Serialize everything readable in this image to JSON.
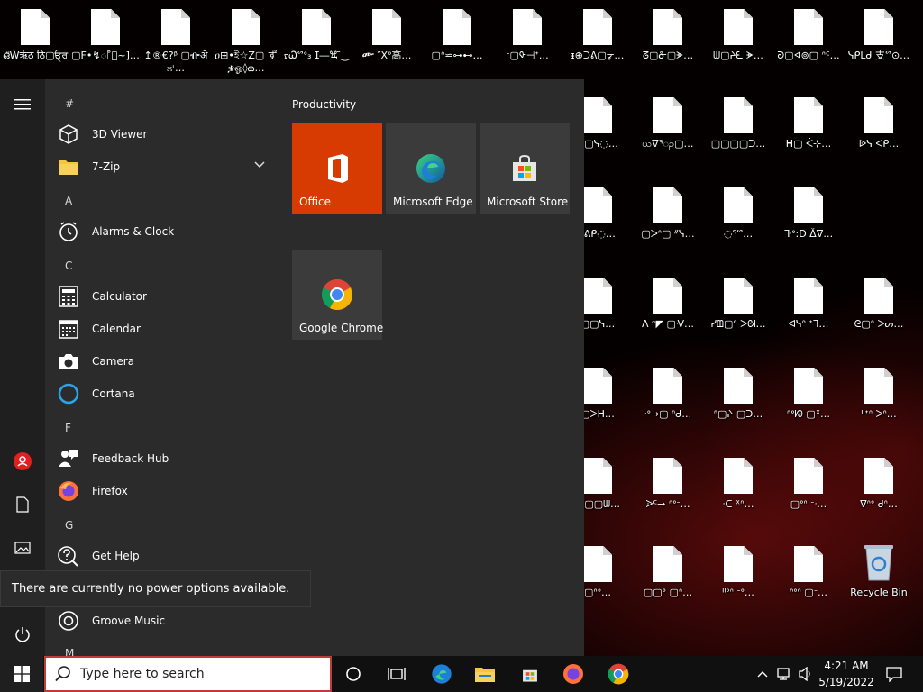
{
  "desktop": {
    "icons_row1": [
      {
        "label": "ഒ̈W̃ऋ॑ठ ठि▢ਓ੍ਰ"
      },
      {
        "label": "▢F•↯ါ ̊ႅ~]…"
      },
      {
        "label": "↥®€?ᵝ ▢ᎇऄ೫ᶥ…"
      },
      {
        "label": "ዐ⊞•ই☆Z▢ ずቌஓ◊ౚ…"
      },
      {
        "label": "ᠷᏇᔥᐤ₃ ⵊ―ꖐ ̄‿"
      },
      {
        "label": "ᎀ ″Xᐤ高…"
      },
      {
        "label": "▢ᐢ⋍⊶⊷…"
      },
      {
        "label": "ᐨ▢ᡐ⊣ᐩ…"
      },
      {
        "label": "ᵻ⊕ᑐᕕ▢ᡒ…"
      },
      {
        "label": "ᘔ▢ᓁ▢ᗘ…"
      },
      {
        "label": "ᗯ▢ᔨᘍ ᗘ…"
      },
      {
        "label": "ᘐ▢ᗏ⊚▢ ᐢᑦ…"
      },
      {
        "label": "ᓭᑭᒪᑯ 支ᔥ⊙…"
      }
    ],
    "icons_grid_labels": [
      [
        "ᑕ▢ᓭ◌…",
        "ယᐁᕐၣ▢…",
        "▢▢▢▢ᑐ…",
        "ᕼ▢ ᐹ⊹…"
      ],
      [
        "ᐠᕕᑭ◌…",
        "▢ᐳᐢ▢ ᐥᓭ…",
        "◌ᕐᔥ…",
        "ᒭᐤ:D ᐂᐁ…",
        "ᐉᓭ ᐸᑭ…"
      ],
      [
        "▢▢ᓭ…",
        "ᐱ ᵔ◤ ▢ᐺ…",
        "ᓯᗶ▢ᐤ ᐳᘛ…",
        "ᐊᓭᐢ ᐩᒣ…",
        "ᘓ▢ᐢ ᐳᔕ…"
      ],
      [
        "▢ᐳᕼ…",
        "ᐧᐤ→▢ ᐢᑯ…",
        "ᐢ▢ᔨ ▢ᑐ…",
        "ᐢᐤᘘ ▢ᕽ…",
        "ᐦᐩᐢ ᐳᐢ…"
      ],
      [
        "▢▢▢ᗯ…",
        "ᐷᑦ→ ᐢᐤᐨ…",
        "ᐧᑕ ᕽᐢ…",
        "▢ᐤᐢ ᐨᐧ…",
        "ᐁᐢᐤ ᑯᐢ…"
      ],
      [
        "▢ᐢᐤ…",
        "▢▢ᐤ ▢ᐢ…",
        "ᐦᐤᐢ ᐨᐤ…",
        "ᐢᐤᐢ ▢ᐨ…",
        "Recycle Bin"
      ]
    ]
  },
  "start_menu": {
    "group_hash": "#",
    "apps": [
      {
        "label": "3D Viewer",
        "icon": "cube-icon"
      },
      {
        "label": "7-Zip",
        "icon": "folder-icon"
      },
      {
        "label": "Alarms & Clock",
        "icon": "clock-icon"
      },
      {
        "label": "Calculator",
        "icon": "calculator-icon"
      },
      {
        "label": "Calendar",
        "icon": "calendar-icon"
      },
      {
        "label": "Camera",
        "icon": "camera-icon"
      },
      {
        "label": "Cortana",
        "icon": "cortana-icon"
      },
      {
        "label": "Feedback Hub",
        "icon": "feedback-icon"
      },
      {
        "label": "Firefox",
        "icon": "firefox-icon"
      },
      {
        "label": "Get Help",
        "icon": "help-icon"
      },
      {
        "label": "Groove Music",
        "icon": "music-icon"
      }
    ],
    "letters": {
      "a": "A",
      "c": "C",
      "f": "F",
      "g": "G",
      "m": "M"
    },
    "tiles_header": "Productivity",
    "tiles": [
      {
        "label": "Office",
        "color": "#d83b01"
      },
      {
        "label": "Microsoft Edge"
      },
      {
        "label": "Microsoft Store"
      },
      {
        "label": "Google Chrome"
      }
    ],
    "power_tooltip": "There are currently no power options available."
  },
  "taskbar": {
    "search_placeholder": "Type here to search",
    "time": "4:21 AM",
    "date": "5/19/2022"
  }
}
